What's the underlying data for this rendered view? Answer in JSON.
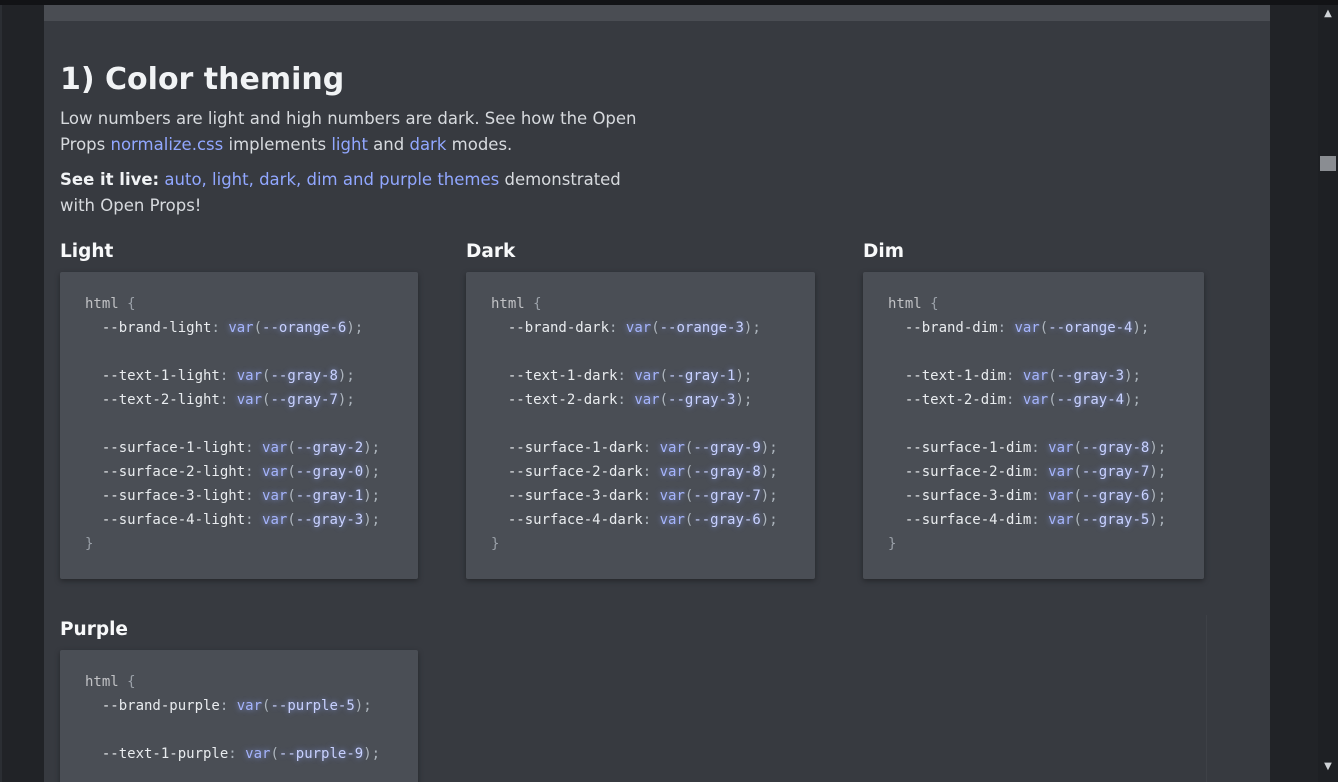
{
  "section": {
    "title": "1) Color theming",
    "para1": {
      "text_before": "Low numbers are light and high numbers are dark. See how the Open Props ",
      "link_normalize": "normalize.css",
      "text_mid1": " implements ",
      "link_light": "light",
      "text_mid2": " and ",
      "link_dark": "dark",
      "text_after": " modes."
    },
    "para2": {
      "strong": "See it live:",
      "link_themes": "auto, light, dark, dim and purple themes",
      "text_after": " demonstrated with Open Props!"
    }
  },
  "themes": [
    {
      "name": "Light",
      "selector": "html",
      "lines": [
        {
          "prop": "--brand-light",
          "var": "--orange-6"
        },
        null,
        {
          "prop": "--text-1-light",
          "var": "--gray-8"
        },
        {
          "prop": "--text-2-light",
          "var": "--gray-7"
        },
        null,
        {
          "prop": "--surface-1-light",
          "var": "--gray-2"
        },
        {
          "prop": "--surface-2-light",
          "var": "--gray-0"
        },
        {
          "prop": "--surface-3-light",
          "var": "--gray-1"
        },
        {
          "prop": "--surface-4-light",
          "var": "--gray-3"
        }
      ]
    },
    {
      "name": "Dark",
      "selector": "html",
      "lines": [
        {
          "prop": "--brand-dark",
          "var": "--orange-3"
        },
        null,
        {
          "prop": "--text-1-dark",
          "var": "--gray-1"
        },
        {
          "prop": "--text-2-dark",
          "var": "--gray-3"
        },
        null,
        {
          "prop": "--surface-1-dark",
          "var": "--gray-9"
        },
        {
          "prop": "--surface-2-dark",
          "var": "--gray-8"
        },
        {
          "prop": "--surface-3-dark",
          "var": "--gray-7"
        },
        {
          "prop": "--surface-4-dark",
          "var": "--gray-6"
        }
      ]
    },
    {
      "name": "Dim",
      "selector": "html",
      "lines": [
        {
          "prop": "--brand-dim",
          "var": "--orange-4"
        },
        null,
        {
          "prop": "--text-1-dim",
          "var": "--gray-3"
        },
        {
          "prop": "--text-2-dim",
          "var": "--gray-4"
        },
        null,
        {
          "prop": "--surface-1-dim",
          "var": "--gray-8"
        },
        {
          "prop": "--surface-2-dim",
          "var": "--gray-7"
        },
        {
          "prop": "--surface-3-dim",
          "var": "--gray-6"
        },
        {
          "prop": "--surface-4-dim",
          "var": "--gray-5"
        }
      ]
    },
    {
      "name": "Purple",
      "selector": "html",
      "lines": [
        {
          "prop": "--brand-purple",
          "var": "--purple-5"
        },
        null,
        {
          "prop": "--text-1-purple",
          "var": "--purple-9"
        }
      ]
    }
  ],
  "code_tokens": {
    "open_brace": "{",
    "close_brace": "}",
    "fn": "var",
    "colon": ":",
    "semicolon": ";",
    "paren_open": "(",
    "paren_close": ")"
  },
  "scrollbar": {
    "up_icon": "▲",
    "down_icon": "▼"
  },
  "colors": {
    "page_bg": "#373a40",
    "card_bg": "#4a4e55",
    "link": "#91a7ff",
    "heading": "#f1f3f5",
    "body_text": "#d7dade"
  }
}
